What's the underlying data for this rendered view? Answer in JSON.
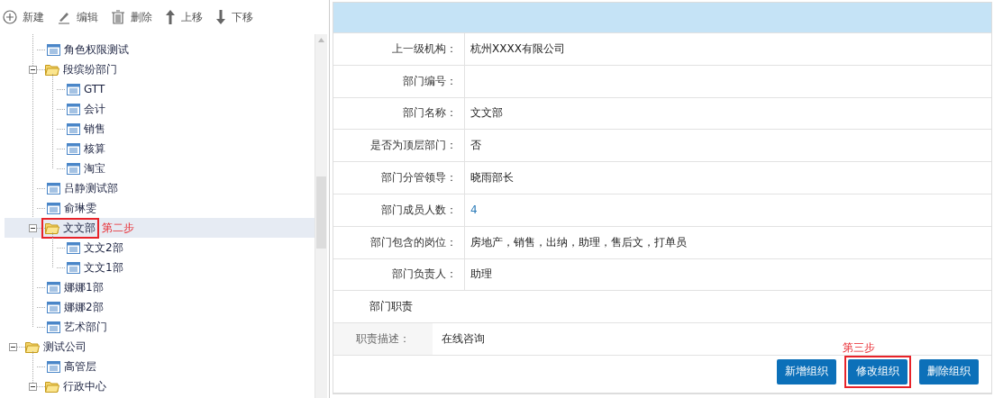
{
  "toolbar": {
    "buttons": [
      {
        "kind": "add",
        "label": "新建"
      },
      {
        "kind": "edit",
        "label": "编辑"
      },
      {
        "kind": "delete",
        "label": "删除"
      },
      {
        "kind": "up",
        "label": "上移"
      },
      {
        "kind": "down",
        "label": "下移"
      }
    ]
  },
  "tree": {
    "continued_children": [
      {
        "label": "角色权限测试",
        "kind": "leaf",
        "selected": false,
        "boxed": false
      },
      {
        "label": "段缤纷部门",
        "kind": "folder",
        "expanded": true,
        "selected": false,
        "boxed": false,
        "children": [
          {
            "label": "GTT",
            "kind": "leaf",
            "selected": false,
            "boxed": false
          },
          {
            "label": "会计",
            "kind": "leaf",
            "selected": false,
            "boxed": false
          },
          {
            "label": "销售",
            "kind": "leaf",
            "selected": false,
            "boxed": false
          },
          {
            "label": "核算",
            "kind": "leaf",
            "selected": false,
            "boxed": false
          },
          {
            "label": "淘宝",
            "kind": "leaf",
            "selected": false,
            "boxed": false
          }
        ]
      },
      {
        "label": "吕静测试部",
        "kind": "leaf",
        "selected": false,
        "boxed": false
      },
      {
        "label": "俞琳雯",
        "kind": "leaf",
        "selected": false,
        "boxed": false
      },
      {
        "label": "文文部",
        "kind": "folder",
        "expanded": true,
        "selected": true,
        "boxed": true,
        "annotation": "第二步",
        "children": [
          {
            "label": "文文2部",
            "kind": "leaf",
            "selected": false,
            "boxed": false
          },
          {
            "label": "文文1部",
            "kind": "leaf",
            "selected": false,
            "boxed": false
          }
        ]
      },
      {
        "label": "娜娜1部",
        "kind": "leaf",
        "selected": false,
        "boxed": false
      },
      {
        "label": "娜娜2部",
        "kind": "leaf",
        "selected": false,
        "boxed": false
      },
      {
        "label": "艺术部门",
        "kind": "leaf",
        "selected": false,
        "boxed": false
      }
    ],
    "items": [
      {
        "label": "测试公司",
        "kind": "folder",
        "expanded": true,
        "selected": false,
        "boxed": false,
        "children": [
          {
            "label": "高管层",
            "kind": "leaf",
            "selected": false,
            "boxed": false
          },
          {
            "label": "行政中心",
            "kind": "folder",
            "expanded": true,
            "selected": false,
            "boxed": false
          }
        ]
      }
    ]
  },
  "details": {
    "rows": [
      {
        "kind": "field",
        "label": "上一级机构：",
        "value": "杭州XXXX有限公司"
      },
      {
        "kind": "field",
        "label": "部门编号："
      },
      {
        "kind": "field",
        "label": "部门名称：",
        "value": "文文部"
      },
      {
        "kind": "field",
        "label": "是否为顶层部门：",
        "value": "否"
      },
      {
        "kind": "field",
        "label": "部门分管领导：",
        "value": "晓雨部长"
      },
      {
        "kind": "link",
        "label": "部门成员人数：",
        "value": "4"
      },
      {
        "kind": "field",
        "label": "部门包含的岗位：",
        "value": "房地产，销售，出纳，助理，售后文，打单员"
      },
      {
        "kind": "field",
        "label": "部门负责人：",
        "value": "助理"
      },
      {
        "kind": "section",
        "label": "部门职责"
      },
      {
        "kind": "description",
        "label": "职责描述：",
        "value": "在线咨询"
      }
    ],
    "buttons": [
      {
        "label": "新增组织",
        "boxed": false
      },
      {
        "label": "修改组织",
        "boxed": true,
        "annotation": "第三步"
      },
      {
        "label": "删除组织",
        "boxed": false
      }
    ]
  }
}
